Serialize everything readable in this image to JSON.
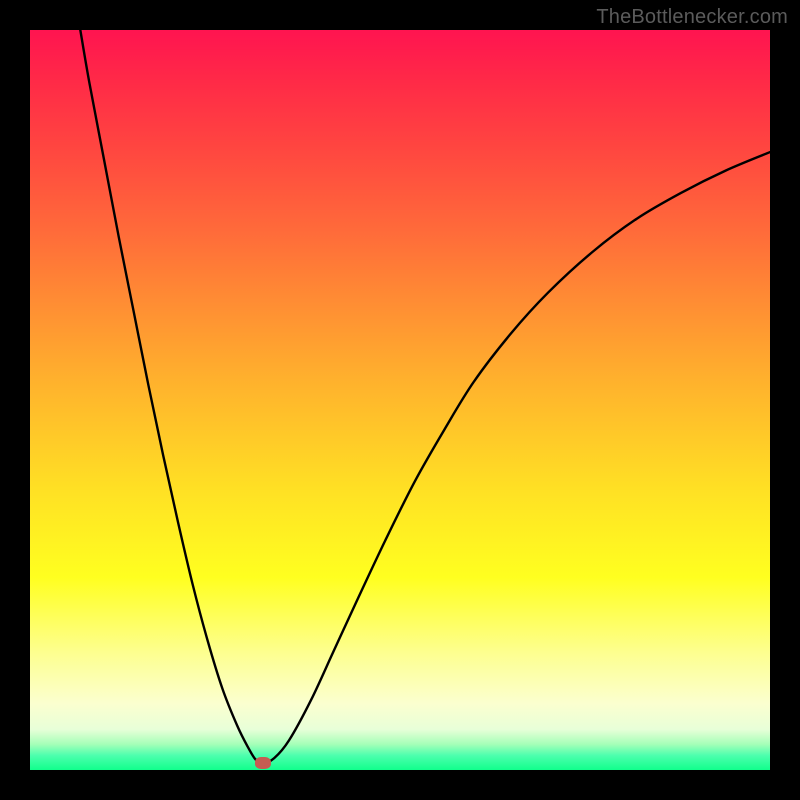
{
  "watermark": "TheBottlenecker.com",
  "chart_data": {
    "type": "line",
    "title": "",
    "xlabel": "",
    "ylabel": "",
    "xlim": [
      0,
      100
    ],
    "ylim": [
      0,
      100
    ],
    "series": [
      {
        "name": "curve",
        "x": [
          6.8,
          8,
          10,
          12,
          14,
          16,
          18,
          20,
          22,
          24,
          26,
          28,
          29.5,
          30.5,
          31.5,
          33,
          35,
          38,
          41,
          44,
          48,
          52,
          56,
          60,
          65,
          70,
          76,
          82,
          88,
          94,
          100
        ],
        "y": [
          100,
          93,
          82.5,
          72,
          62,
          52,
          42.5,
          33.5,
          25,
          17.5,
          11,
          6,
          3,
          1.4,
          0.9,
          1.6,
          4,
          9.5,
          16,
          22.5,
          31,
          39,
          46,
          52.5,
          59,
          64.5,
          70,
          74.5,
          78,
          81,
          83.5
        ]
      }
    ],
    "marker": {
      "x": 31.5,
      "y": 0.9,
      "color": "#c65c52"
    },
    "gradient_stops": [
      {
        "pos": 0,
        "color": "#ff1450"
      },
      {
        "pos": 0.5,
        "color": "#ffb02d"
      },
      {
        "pos": 0.74,
        "color": "#ffff20"
      },
      {
        "pos": 1.0,
        "color": "#11ff8c"
      }
    ]
  }
}
